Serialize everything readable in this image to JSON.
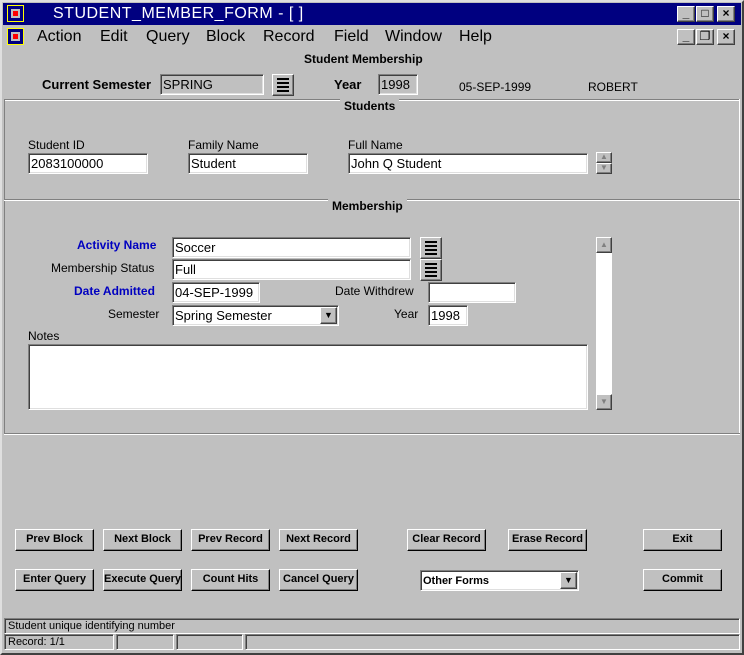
{
  "window": {
    "title": "STUDENT_MEMBER_FORM - [ ]",
    "controls": {
      "minimize": "_",
      "maximize": "□",
      "close": "×"
    },
    "mdi_controls": {
      "minimize": "_",
      "restore": "❐",
      "close": "×"
    }
  },
  "menu": [
    "Action",
    "Edit",
    "Query",
    "Block",
    "Record",
    "Field",
    "Window",
    "Help"
  ],
  "header": {
    "title": "Student Membership",
    "current_semester_label": "Current Semester",
    "current_semester_value": "SPRING",
    "year_label": "Year",
    "year_value": "1998",
    "date": "05-SEP-1999",
    "user": "ROBERT"
  },
  "students": {
    "section_title": "Students",
    "student_id_label": "Student ID",
    "student_id_value": "2083100000",
    "family_name_label": "Family Name",
    "family_name_value": "Student",
    "full_name_label": "Full Name",
    "full_name_value": "John Q Student"
  },
  "membership": {
    "section_title": "Membership",
    "activity_name_label": "Activity Name",
    "activity_name_value": "Soccer",
    "membership_status_label": "Membership Status",
    "membership_status_value": "Full",
    "date_admitted_label": "Date Admitted",
    "date_admitted_value": "04-SEP-1999",
    "date_withdrew_label": "Date Withdrew",
    "date_withdrew_value": "",
    "semester_label": "Semester",
    "semester_value": "Spring Semester",
    "year_label": "Year",
    "year_value": "1998",
    "notes_label": "Notes",
    "notes_value": ""
  },
  "buttons": {
    "prev_block": "Prev Block",
    "next_block": "Next Block",
    "prev_record": "Prev Record",
    "next_record": "Next Record",
    "clear_record": "Clear Record",
    "erase_record": "Erase Record",
    "exit": "Exit",
    "enter_query": "Enter Query",
    "execute_query": "Execute Query",
    "count_hits": "Count Hits",
    "cancel_query": "Cancel Query",
    "other_forms": "Other Forms",
    "commit": "Commit"
  },
  "status": {
    "hint": "Student unique identifying number",
    "record": "Record: 1/1"
  },
  "icons": {
    "app_icon": "oracle-forms-icon",
    "lov_icon": "list-of-values-icon",
    "dropdown_icon": "chevron-down-icon",
    "scroll_up_icon": "scroll-up-icon",
    "scroll_down_icon": "scroll-down-icon"
  },
  "colors": {
    "titlebar": "#000080",
    "required_label": "#0000c0",
    "face": "#c0c0c0"
  }
}
